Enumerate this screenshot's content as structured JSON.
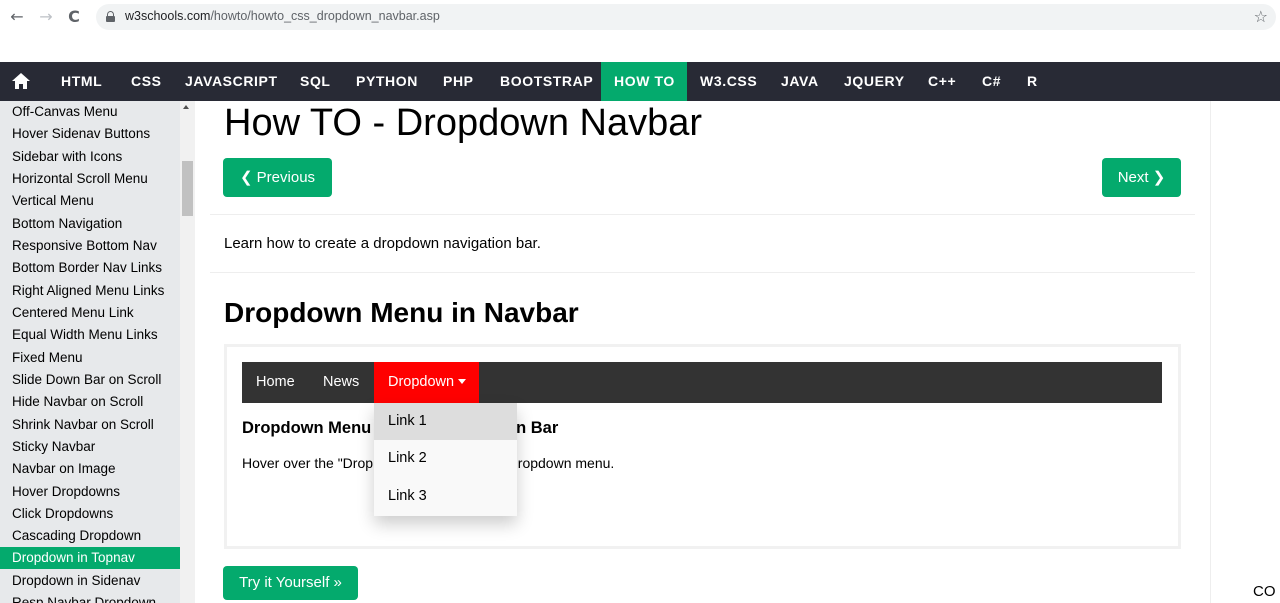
{
  "browser": {
    "back_icon": "←",
    "forward_icon": "→",
    "reload_icon": "C",
    "url_host": "w3schools.com",
    "url_path": "/howto/howto_css_dropdown_navbar.asp",
    "star_icon": "☆"
  },
  "topnav": {
    "items": [
      "HTML",
      "CSS",
      "JAVASCRIPT",
      "SQL",
      "PYTHON",
      "PHP",
      "BOOTSTRAP",
      "HOW TO",
      "W3.CSS",
      "JAVA",
      "JQUERY",
      "C++",
      "C#",
      "R"
    ],
    "active": "HOW TO",
    "accent": "#04aa6d",
    "background": "#282a35"
  },
  "sidebar": {
    "items": [
      "Off-Canvas Menu",
      "Hover Sidenav Buttons",
      "Sidebar with Icons",
      "Horizontal Scroll Menu",
      "Vertical Menu",
      "Bottom Navigation",
      "Responsive Bottom Nav",
      "Bottom Border Nav Links",
      "Right Aligned Menu Links",
      "Centered Menu Link",
      "Equal Width Menu Links",
      "Fixed Menu",
      "Slide Down Bar on Scroll",
      "Hide Navbar on Scroll",
      "Shrink Navbar on Scroll",
      "Sticky Navbar",
      "Navbar on Image",
      "Hover Dropdowns",
      "Click Dropdowns",
      "Cascading Dropdown",
      "Dropdown in Topnav",
      "Dropdown in Sidenav",
      "Resp Navbar Dropdown"
    ],
    "active": "Dropdown in Topnav"
  },
  "main": {
    "title": "How TO - Dropdown Navbar",
    "prev_label": "❮ Previous",
    "next_label": "Next ❯",
    "intro": "Learn how to create a dropdown navigation bar.",
    "section_title": "Dropdown Menu in Navbar",
    "try_label": "Try it Yourself »"
  },
  "demo": {
    "nav_items": [
      "Home",
      "News",
      "Dropdown"
    ],
    "heading": "Dropdown Menu inside a Navigation Bar",
    "heading_visible_left": "Dropdown Menu",
    "heading_visible_right": "on Bar",
    "paragraph_visible_left": "Hover over the \"Drop",
    "paragraph_visible_right": "dropdown menu.",
    "dropdown_links": [
      "Link 1",
      "Link 2",
      "Link 3"
    ],
    "hovered_link": "Link 1",
    "active_color": "#ff0000"
  },
  "edge_text": "CO"
}
